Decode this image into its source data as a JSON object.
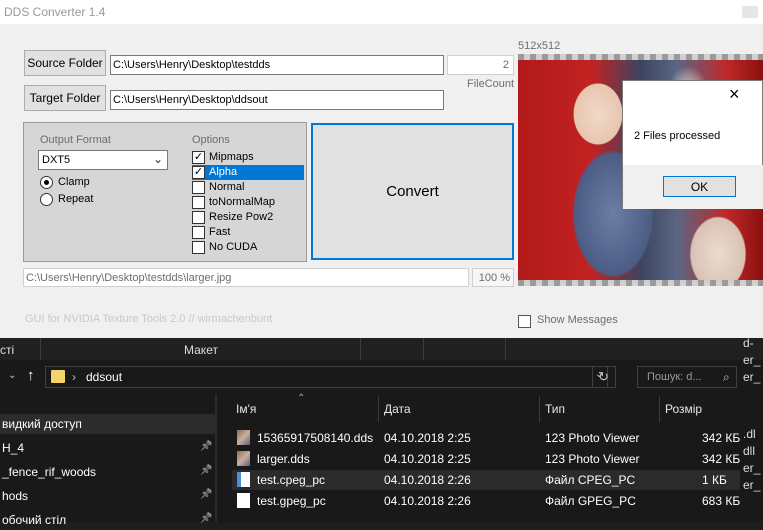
{
  "app": {
    "title": "DDS Converter 1.4",
    "source_button": "Source Folder",
    "target_button": "Target Folder",
    "source_path": "C:\\Users\\Henry\\Desktop\\testdds",
    "target_path": "C:\\Users\\Henry\\Desktop\\ddsout",
    "file_count": "2",
    "file_count_label": "FileCount",
    "output_format_label": "Output Format",
    "output_format_value": "DXT5",
    "clamp_label": "Clamp",
    "repeat_label": "Repeat",
    "options_label": "Options",
    "options": [
      {
        "label": "Mipmaps",
        "checked": true
      },
      {
        "label": "Alpha",
        "checked": true
      },
      {
        "label": "Normal",
        "checked": false
      },
      {
        "label": "toNormalMap",
        "checked": false
      },
      {
        "label": "Resize Pow2",
        "checked": false
      },
      {
        "label": "Fast",
        "checked": false
      },
      {
        "label": "No CUDA",
        "checked": false
      }
    ],
    "convert_button": "Convert",
    "current_file": "C:\\Users\\Henry\\Desktop\\testdds\\larger.jpg",
    "progress_text": "100 %",
    "progress": 1.0,
    "footer_text": "GUI for NVIDIA Texture Tools 2.0 // wirmachenbunt",
    "show_messages_label": "Show Messages",
    "preview_size": "512x512"
  },
  "dialog": {
    "message": "2 Files processed",
    "ok_button": "OK",
    "close_icon": "×"
  },
  "explorer": {
    "ribbon_left": "сті",
    "ribbon_label": "Макет",
    "breadcrumb_folder": "ddsout",
    "search_placeholder": "Пошук: d...",
    "columns": [
      "Ім'я",
      "Дата",
      "Тип",
      "Розмір"
    ],
    "files": [
      {
        "name": "15365917508140.dds",
        "date": "04.10.2018 2:25",
        "type": "123 Photo Viewer",
        "size": "342 КБ",
        "icon": "image-file-icon"
      },
      {
        "name": "larger.dds",
        "date": "04.10.2018 2:25",
        "type": "123 Photo Viewer",
        "size": "342 КБ",
        "icon": "image-file-icon"
      },
      {
        "name": "test.cpeg_pc",
        "date": "04.10.2018 2:26",
        "type": "Файл CPEG_PC",
        "size": "1 КБ",
        "icon": "generic-file-icon"
      },
      {
        "name": "test.gpeg_pc",
        "date": "04.10.2018 2:26",
        "type": "Файл GPEG_PC",
        "size": "683 КБ",
        "icon": "blank-file-icon"
      }
    ],
    "nav": [
      {
        "label": "видкий доступ",
        "pinned": false
      },
      {
        "label": "H_4",
        "pinned": true
      },
      {
        "label": "_fence_rif_woods",
        "pinned": true
      },
      {
        "label": "hods",
        "pinned": true
      },
      {
        "label": "обочий стіл",
        "pinned": true
      }
    ],
    "right_fragments": [
      "d-",
      "er_",
      "er_",
      ".dl",
      "dll",
      "er_",
      "er_"
    ]
  },
  "colors": {
    "selection": "#0078d7",
    "convert_border": "#0078d7",
    "explorer_bg": "#191919"
  }
}
